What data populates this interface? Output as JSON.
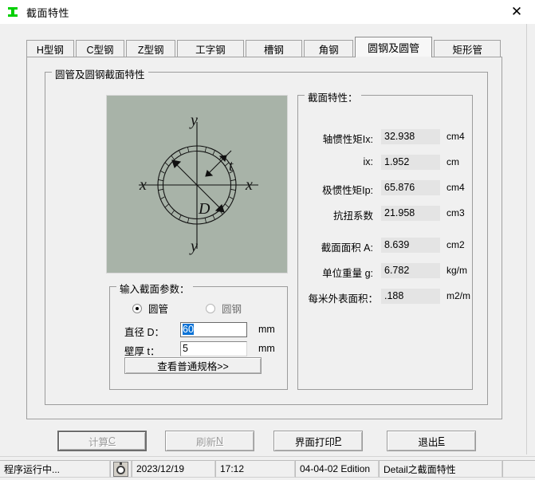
{
  "window": {
    "title": "截面特性",
    "icon": "i-beam-icon",
    "close_label": "✕"
  },
  "tabs": [
    {
      "label": "H型钢",
      "selected": false
    },
    {
      "label": "C型钢",
      "selected": false
    },
    {
      "label": "Z型钢",
      "selected": false
    },
    {
      "label": "工字钢",
      "selected": false
    },
    {
      "label": "槽钢",
      "selected": false
    },
    {
      "label": "角钢",
      "selected": false
    },
    {
      "label": "圆钢及圆管",
      "selected": true
    },
    {
      "label": "矩形管",
      "selected": false
    }
  ],
  "main_group": {
    "title": "圆管及圆钢截面特性"
  },
  "diagram": {
    "name": "circular-tube-cross-section",
    "labels": {
      "y_top": "y",
      "y_bottom": "y",
      "x_left": "x",
      "x_right": "x",
      "diameter": "D",
      "thickness": "t"
    }
  },
  "params_group": {
    "title": "输入截面参数：",
    "radios": [
      {
        "label": "圆管",
        "selected": true
      },
      {
        "label": "圆钢",
        "selected": false
      }
    ],
    "fields": [
      {
        "label": "直径 D：",
        "value": "60",
        "unit": "mm",
        "selected": true
      },
      {
        "label": "壁厚 t：",
        "value": "5",
        "unit": "mm",
        "selected": false
      }
    ],
    "specs_button": "查看普通规格>>"
  },
  "properties_group": {
    "title": "截面特性：",
    "rows": [
      {
        "label": "轴惯性矩Ix:",
        "value": "32.938",
        "unit": "cm4"
      },
      {
        "label": "ix:",
        "value": "1.952",
        "unit": "cm"
      },
      {
        "label": "极惯性矩Ip:",
        "value": "65.876",
        "unit": "cm4"
      },
      {
        "label": "抗扭系数",
        "value": "21.958",
        "unit": "cm3"
      },
      {
        "label": "截面面积 A:",
        "value": "8.639",
        "unit": "cm2"
      },
      {
        "label": "单位重量 g:",
        "value": "6.782",
        "unit": "kg/m"
      },
      {
        "label": "每米外表面积：",
        "value": ".188",
        "unit": "m2/m"
      }
    ]
  },
  "bottom_buttons": {
    "calc": {
      "text": "计算",
      "accel": "C",
      "disabled": true,
      "default": true
    },
    "refresh": {
      "text": "刷新",
      "accel": "N",
      "disabled": true,
      "default": false
    },
    "print": {
      "text": "界面打印",
      "accel": "P",
      "disabled": false,
      "default": false
    },
    "exit": {
      "text": "退出",
      "accel": "E",
      "disabled": false,
      "default": false
    }
  },
  "statusbar": {
    "status": "程序运行中...",
    "icon": "stopwatch-icon",
    "date": "2023/12/19",
    "time": "17:12",
    "edition": "04-04-02 Edition",
    "detail": "Detail之截面特性",
    "extra": ""
  },
  "colors": {
    "diagram_bg": "#a8b3a8",
    "selection": "#0a72d6",
    "readonly_field": "#e4e4e4",
    "window_bg": "#f0f0f0",
    "icon_green": "#00d000"
  }
}
